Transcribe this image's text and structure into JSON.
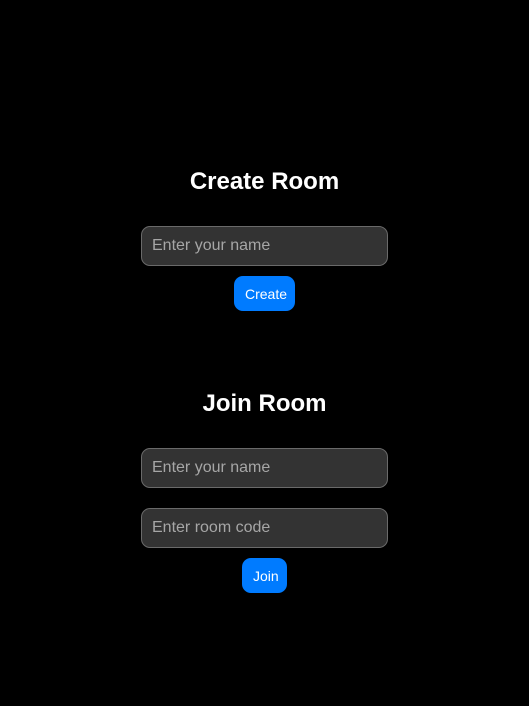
{
  "create_room": {
    "title": "Create Room",
    "name_placeholder": "Enter your name",
    "button_label": "Create"
  },
  "join_room": {
    "title": "Join Room",
    "name_placeholder": "Enter your name",
    "code_placeholder": "Enter room code",
    "button_label": "Join"
  },
  "colors": {
    "background": "#000000",
    "accent": "#007bff",
    "input_background": "#333333"
  }
}
